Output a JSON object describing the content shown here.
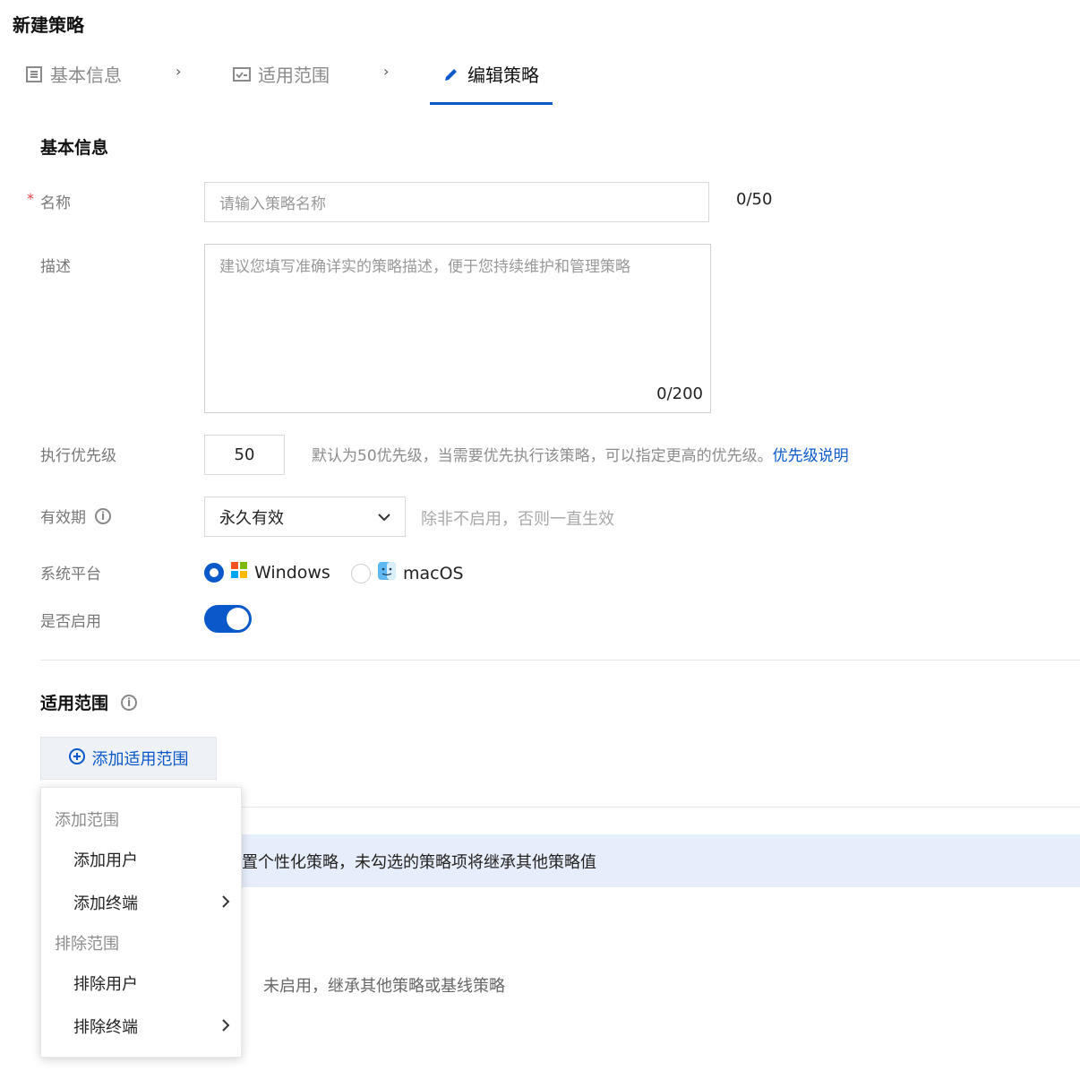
{
  "page": {
    "title": "新建策略"
  },
  "steps": [
    {
      "label": "基本信息",
      "icon": "list-icon"
    },
    {
      "label": "适用范围",
      "icon": "checklist-icon"
    },
    {
      "label": "编辑策略",
      "icon": "pencil-icon"
    }
  ],
  "basic": {
    "section_title": "基本信息",
    "name_label": "名称",
    "name_placeholder": "请输入策略名称",
    "name_counter": "0/50",
    "desc_label": "描述",
    "desc_placeholder": "建议您填写准确详实的策略描述，便于您持续维护和管理策略",
    "desc_counter": "0/200",
    "priority_label": "执行优先级",
    "priority_value": "50",
    "priority_hint": "默认为50优先级，当需要优先执行该策略，可以指定更高的优先级。",
    "priority_link": "优先级说明",
    "validity_label": "有效期",
    "validity_value": "永久有效",
    "validity_hint": "除非不启用，否则一直生效",
    "platform_label": "系统平台",
    "platform_options": [
      "Windows",
      "macOS"
    ],
    "platform_selected": "Windows",
    "enable_label": "是否启用",
    "enabled": true
  },
  "scope": {
    "section_title": "适用范围",
    "add_button": "添加适用范围",
    "info_text": "置个性化策略，未勾选的策略项将继承其他策略值",
    "row_text": "未启用，继承其他策略或基线策略"
  },
  "menu": {
    "group_add": "添加范围",
    "add_user": "添加用户",
    "add_terminal": "添加终端",
    "group_exclude": "排除范围",
    "exclude_user": "排除用户",
    "exclude_terminal": "排除终端"
  },
  "colors": {
    "accent": "#0a58ca",
    "required": "#e54545",
    "info_bg": "#e6edfb"
  }
}
